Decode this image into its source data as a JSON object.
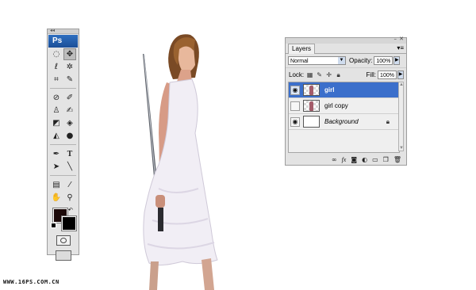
{
  "tools_panel": {
    "header_grip": "◂◂",
    "app_logo": "Ps",
    "colors": {
      "foreground": "#1c0a0a",
      "background": "#000000"
    }
  },
  "layers_panel": {
    "tab_label": "Layers",
    "blend_mode": "Normal",
    "opacity_label": "Opacity:",
    "opacity_value": "100%",
    "lock_label": "Lock:",
    "fill_label": "Fill:",
    "fill_value": "100%",
    "layers": [
      {
        "name": "girl",
        "visible": true,
        "selected": true,
        "italic": false
      },
      {
        "name": "girl copy",
        "visible": false,
        "selected": false,
        "italic": false
      },
      {
        "name": "Background",
        "visible": true,
        "selected": false,
        "italic": true,
        "locked": true
      }
    ],
    "accent": "#3b6fcb"
  },
  "watermark": "WWW.16PS.COM.CN"
}
